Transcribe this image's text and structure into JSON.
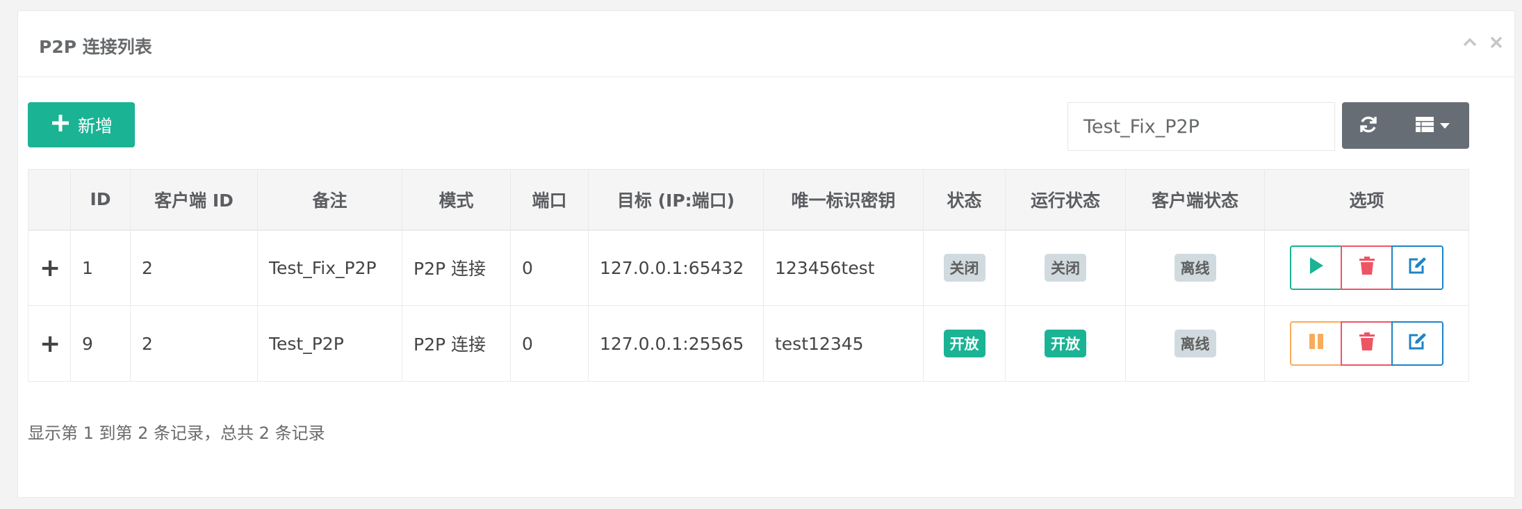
{
  "panel": {
    "title": "P2P 连接列表",
    "collapse_icon": "chevron-up-icon",
    "close_icon": "close-icon"
  },
  "toolbar": {
    "add_label": "新增",
    "add_icon": "plus-icon",
    "search_value": "Test_Fix_P2P",
    "refresh_icon": "refresh-icon",
    "columns_icon": "list-icon"
  },
  "table": {
    "headers": [
      "",
      "ID",
      "客户端 ID",
      "备注",
      "模式",
      "端口",
      "目标 (IP:端口)",
      "唯一标识密钥",
      "状态",
      "运行状态",
      "客户端状态",
      "选项"
    ],
    "rows": [
      {
        "expand": "+",
        "id": "1",
        "client_id": "2",
        "remark": "Test_Fix_P2P",
        "mode": "P2P 连接",
        "port": "0",
        "target": "127.0.0.1:65432",
        "key": "123456test",
        "status": "关闭",
        "run_status": "关闭",
        "client_status": "离线",
        "action": "play"
      },
      {
        "expand": "+",
        "id": "9",
        "client_id": "2",
        "remark": "Test_P2P",
        "mode": "P2P 连接",
        "port": "0",
        "target": "127.0.0.1:25565",
        "key": "test12345",
        "status": "开放",
        "run_status": "开放",
        "client_status": "离线",
        "action": "pause"
      }
    ]
  },
  "footer": {
    "summary": "显示第 1 到第 2 条记录，总共 2 条记录"
  },
  "colors": {
    "primary": "#1ab394",
    "danger": "#ed5565",
    "warning": "#f8ac59",
    "info": "#1c84c6",
    "expand": "#3479f6",
    "badge_gray": "#d1dade"
  }
}
